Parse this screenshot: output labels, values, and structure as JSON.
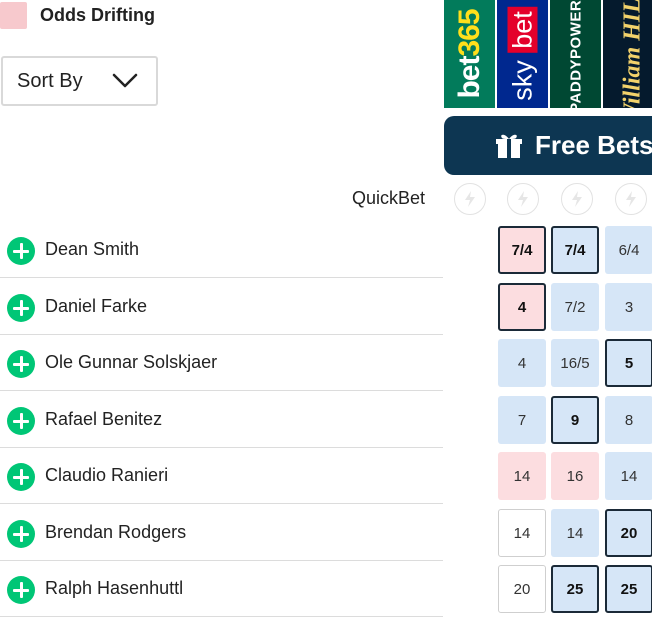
{
  "legend": {
    "label": "Odds Drifting"
  },
  "sort": {
    "label": "Sort By"
  },
  "bookmakers": [
    {
      "name": "bet365"
    },
    {
      "name": "sky bet"
    },
    {
      "name": "PADDYPOWER."
    },
    {
      "name": "William HILL"
    }
  ],
  "free_bets": {
    "label": "Free Bets"
  },
  "quickbet": {
    "label": "QuickBet"
  },
  "colors": {
    "drift": "#fcdde0",
    "shorten": "#d6e6f7",
    "add": "#00c676",
    "freebets": "#0d3652"
  },
  "runners": [
    {
      "name": "Dean Smith",
      "odds": [
        {
          "v": "7/4",
          "c": "pink",
          "best": true
        },
        {
          "v": "7/4",
          "c": "blue",
          "best": true
        },
        {
          "v": "6/4",
          "c": "blue",
          "best": false
        }
      ]
    },
    {
      "name": "Daniel Farke",
      "odds": [
        {
          "v": "4",
          "c": "pink",
          "best": true
        },
        {
          "v": "7/2",
          "c": "blue",
          "best": false
        },
        {
          "v": "3",
          "c": "blue",
          "best": false
        }
      ]
    },
    {
      "name": "Ole Gunnar Solskjaer",
      "odds": [
        {
          "v": "4",
          "c": "blue",
          "best": false
        },
        {
          "v": "16/5",
          "c": "blue",
          "best": false
        },
        {
          "v": "5",
          "c": "blue",
          "best": true
        }
      ]
    },
    {
      "name": "Rafael Benitez",
      "odds": [
        {
          "v": "7",
          "c": "blue",
          "best": false
        },
        {
          "v": "9",
          "c": "blue",
          "best": true
        },
        {
          "v": "8",
          "c": "blue",
          "best": false
        }
      ]
    },
    {
      "name": "Claudio Ranieri",
      "odds": [
        {
          "v": "14",
          "c": "pink",
          "best": false
        },
        {
          "v": "16",
          "c": "pink",
          "best": false
        },
        {
          "v": "14",
          "c": "blue",
          "best": false
        }
      ]
    },
    {
      "name": "Brendan Rodgers",
      "odds": [
        {
          "v": "14",
          "c": "white",
          "best": false
        },
        {
          "v": "14",
          "c": "blue",
          "best": false
        },
        {
          "v": "20",
          "c": "blue",
          "best": true
        }
      ]
    },
    {
      "name": "Ralph Hasenhuttl",
      "odds": [
        {
          "v": "20",
          "c": "white",
          "best": false
        },
        {
          "v": "25",
          "c": "blue",
          "best": true
        },
        {
          "v": "25",
          "c": "blue",
          "best": true
        }
      ]
    }
  ]
}
